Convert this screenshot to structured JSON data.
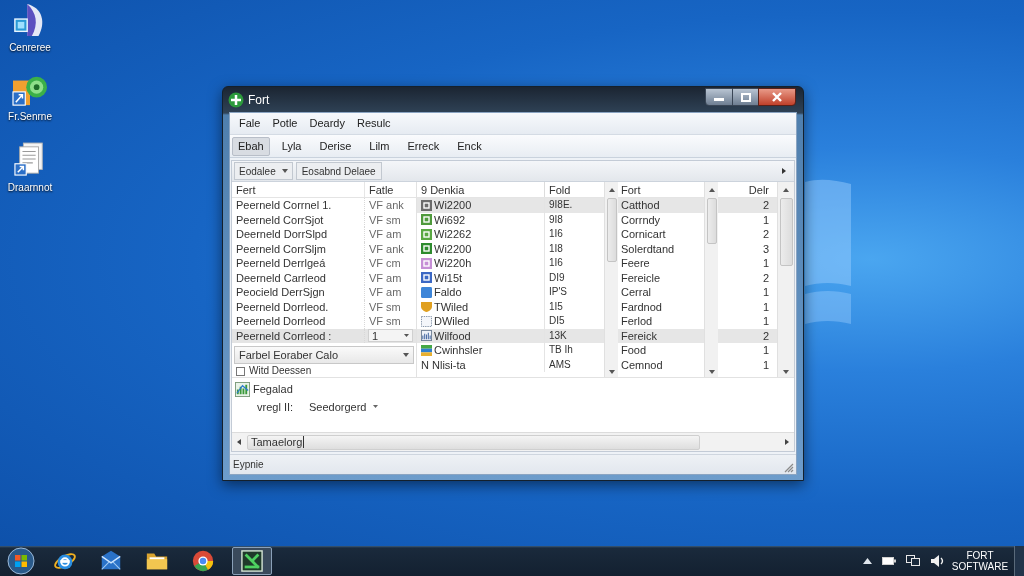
{
  "desktop_icons": [
    {
      "label": "Cenreree",
      "kind": "sail"
    },
    {
      "label": "Fr.Senrne",
      "kind": "globe"
    },
    {
      "label": "Draarnnot",
      "kind": "pages"
    }
  ],
  "window": {
    "title": "Fort"
  },
  "menu": [
    "Fale",
    "Potle",
    "Deardy",
    "Resulc"
  ],
  "toolbar_tabs": [
    {
      "label": "Ebah",
      "selected": true
    },
    {
      "label": "Lyla",
      "selected": false
    },
    {
      "label": "Derise",
      "selected": false
    },
    {
      "label": "Lilm",
      "selected": false
    },
    {
      "label": "Erreck",
      "selected": false
    },
    {
      "label": "Enck",
      "selected": false
    }
  ],
  "filter_bar": {
    "dropdown": "Eodalee",
    "button": "Eosabnd Delaee"
  },
  "left_list": {
    "columns": [
      "Fert",
      "Fatle"
    ],
    "rows": [
      {
        "cells": [
          "Peerneld Corrnel 1.",
          "VF ank"
        ],
        "kind": "text",
        "selected": false
      },
      {
        "cells": [
          "Peerneld CorrSjot",
          "VF sm"
        ],
        "kind": "text",
        "selected": false
      },
      {
        "cells": [
          "Deerneld DorrSlpd",
          "VF am"
        ],
        "kind": "text",
        "selected": false
      },
      {
        "cells": [
          "Peerneld CorrSljm",
          "VF ank"
        ],
        "kind": "text",
        "selected": false
      },
      {
        "cells": [
          "Peerneld Derrlgeá",
          "VF cm"
        ],
        "kind": "text",
        "selected": false
      },
      {
        "cells": [
          "Deerneld Carrleod",
          "VF am"
        ],
        "kind": "text",
        "selected": false
      },
      {
        "cells": [
          "Peocield DerrSjgn",
          "VF am"
        ],
        "kind": "text",
        "selected": false
      },
      {
        "cells": [
          "Peerneld Dorrleod.",
          "VF sm"
        ],
        "kind": "text",
        "selected": false
      },
      {
        "cells": [
          "Peerneld Dorrleod",
          "VF sm"
        ],
        "kind": "text",
        "selected": false
      },
      {
        "cells": [
          "Peerneld Corrleod :",
          "1"
        ],
        "kind": "dropdown",
        "selected": true
      }
    ],
    "dropdown": "Farbel Eoraber Calo",
    "footer": {
      "label": "Witd Deessen",
      "checked": false
    }
  },
  "right_list": {
    "columns": [
      "9 Denkia",
      "Fold",
      "Fort",
      "Delr"
    ],
    "rows": [
      {
        "icon": {
          "kind": "tile",
          "color": "#6b6b6b"
        },
        "cells": [
          "Wi2200",
          "9I8E.",
          "Catthod",
          "2"
        ],
        "selected": true
      },
      {
        "icon": {
          "kind": "tile",
          "color": "#4f9a3c"
        },
        "cells": [
          "Wi692",
          "9I8",
          "Corrndy",
          "1"
        ],
        "selected": false
      },
      {
        "icon": {
          "kind": "tile",
          "color": "#5aa843"
        },
        "cells": [
          "Wi2262",
          "1I6",
          "Cornicart",
          "2"
        ],
        "selected": false
      },
      {
        "icon": {
          "kind": "tile",
          "color": "#2e8b2e"
        },
        "cells": [
          "Wi2200",
          "1I8",
          "Solerdtand",
          "3"
        ],
        "selected": false
      },
      {
        "icon": {
          "kind": "tile",
          "color": "#c68fd6"
        },
        "cells": [
          "Wi220h",
          "1I6",
          "Feere",
          "1"
        ],
        "selected": false
      },
      {
        "icon": {
          "kind": "tile",
          "color": "#3c68c4"
        },
        "cells": [
          "Wi15t",
          "DI9",
          "Fereicle",
          "2"
        ],
        "selected": false
      },
      {
        "icon": {
          "kind": "block",
          "color": "#3d85d8"
        },
        "cells": [
          "Faldo",
          "IP'S",
          "Cerral",
          "1"
        ],
        "selected": false
      },
      {
        "icon": {
          "kind": "shield",
          "color": "#e0a020"
        },
        "cells": [
          "TWiled",
          "1I5",
          "Fardnod",
          "1"
        ],
        "selected": false
      },
      {
        "icon": {
          "kind": "frame"
        },
        "cells": [
          "DWiled",
          "DI5",
          "Ferlod",
          "1"
        ],
        "selected": false
      },
      {
        "icon": {
          "kind": "picture"
        },
        "cells": [
          "Wilfood",
          "13K",
          "Fereick",
          "2"
        ],
        "selected": true
      },
      {
        "icon": {
          "kind": "stack"
        },
        "cells": [
          "Cwinhsler",
          "TB Ih",
          "Food",
          "1"
        ],
        "selected": false
      },
      {
        "icon": {
          "kind": "none"
        },
        "cells": [
          "N Nlisi-ta",
          "AMS",
          "Cemnod",
          "1"
        ],
        "selected": false
      }
    ]
  },
  "details": {
    "title": "Fegalad",
    "field_label": "vregl II:",
    "field_value": "Seedorgerd"
  },
  "bottom_field": {
    "value": "Tamaelorg"
  },
  "status_bar": "Eypnie",
  "taskbar": {
    "apps": [
      {
        "kind": "browser",
        "selected": false
      },
      {
        "kind": "mail",
        "selected": false
      },
      {
        "kind": "folder",
        "selected": false
      },
      {
        "kind": "chrome",
        "selected": false
      },
      {
        "kind": "app",
        "selected": true
      }
    ],
    "tray_text": [
      "FORT",
      "SOFTWARE"
    ]
  }
}
